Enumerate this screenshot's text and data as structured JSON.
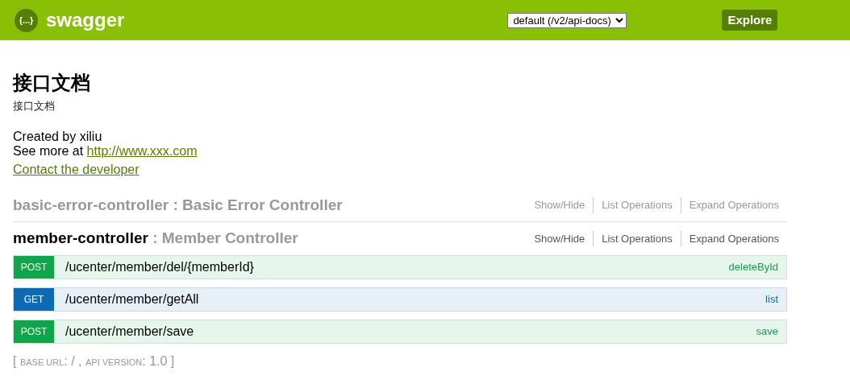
{
  "header": {
    "logo_text": "{...}",
    "brand": "swagger",
    "spec_select": "default (/v2/api-docs)",
    "explore_button": "Explore"
  },
  "info": {
    "title": "接口文档",
    "description": "接口文档",
    "created_by": "Created by xiliu",
    "see_more_prefix": "See more at ",
    "see_more_link": "http://www.xxx.com",
    "contact_link": "Contact the developer"
  },
  "controllers": [
    {
      "name": "basic-error-controller",
      "description": " : Basic Error Controller",
      "expanded": false,
      "actions": [
        "Show/Hide",
        "List Operations",
        "Expand Operations"
      ]
    },
    {
      "name": "member-controller",
      "description": " : Member Controller",
      "expanded": true,
      "actions": [
        "Show/Hide",
        "List Operations",
        "Expand Operations"
      ],
      "operations": [
        {
          "method": "POST",
          "path": "/ucenter/member/del/{memberId}",
          "summary": "deleteById"
        },
        {
          "method": "GET",
          "path": "/ucenter/member/getAll",
          "summary": "list"
        },
        {
          "method": "POST",
          "path": "/ucenter/member/save",
          "summary": "save"
        }
      ]
    }
  ],
  "footer": [
    {
      "kind": "plain",
      "text": "[ "
    },
    {
      "kind": "caps",
      "text": "BASE URL"
    },
    {
      "kind": "plain",
      "text": ": / , "
    },
    {
      "kind": "caps",
      "text": "API VERSION"
    },
    {
      "kind": "plain",
      "text": ": 1.0 ]"
    }
  ]
}
